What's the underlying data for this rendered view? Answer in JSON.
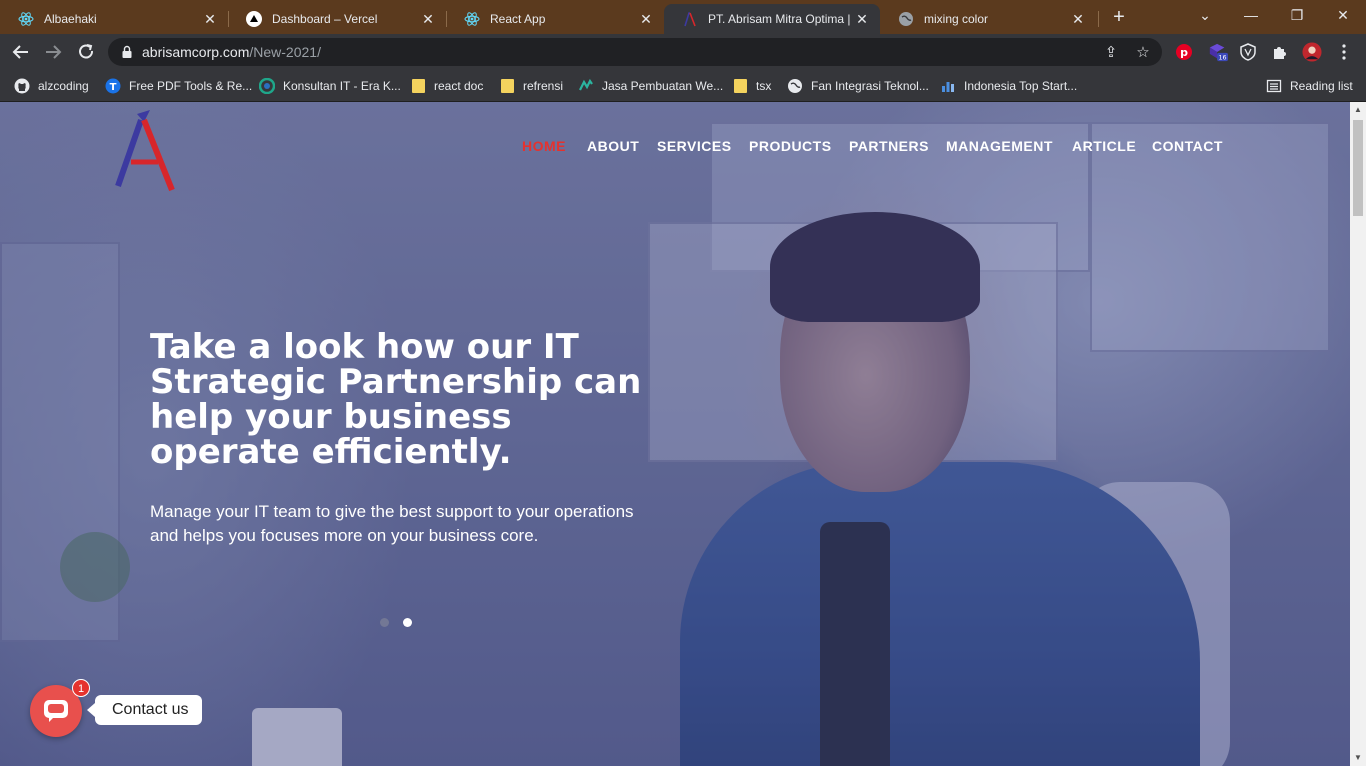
{
  "browser": {
    "tabs": [
      {
        "title": "Albaehaki",
        "icon": "react-icon",
        "active": false
      },
      {
        "title": "Dashboard – Vercel",
        "icon": "vercel-icon",
        "active": false
      },
      {
        "title": "React App",
        "icon": "react-icon",
        "active": false
      },
      {
        "title": "PT. Abrisam Mitra Optima | IT",
        "icon": "abrisam-icon",
        "active": true
      },
      {
        "title": "mixing color",
        "icon": "globe-icon",
        "active": false
      }
    ],
    "new_tab": "+",
    "url_host": "abrisamcorp.com",
    "url_path": "/New-2021/",
    "extension_badge": "16",
    "bookmarks": [
      {
        "label": "alzcoding",
        "icon": "github-icon"
      },
      {
        "label": "Free PDF Tools & Re...",
        "icon": "pdf-tool-icon"
      },
      {
        "label": "Konsultan IT - Era K...",
        "icon": "era-icon"
      },
      {
        "label": "react doc",
        "icon": "folder-icon"
      },
      {
        "label": "refrensi",
        "icon": "folder-icon"
      },
      {
        "label": "Jasa Pembuatan We...",
        "icon": "jasa-icon"
      },
      {
        "label": "tsx",
        "icon": "folder-icon"
      },
      {
        "label": "Fan Integrasi Teknol...",
        "icon": "globe-icon"
      },
      {
        "label": "Indonesia Top Start...",
        "icon": "chart-icon"
      }
    ],
    "reading_list": "Reading list"
  },
  "site": {
    "nav": {
      "home": "HOME",
      "about": "ABOUT",
      "services": "SERVICES",
      "products": "PRODUCTS",
      "partners": "PARTNERS",
      "management": "MANAGEMENT",
      "article": "ARTICLE",
      "contact": "CONTACT"
    },
    "hero": {
      "headline": "Take a look how our IT Strategic Partnership can help your business operate efficiently.",
      "subline": "Manage your IT team to give the best support to your operations and helps you focuses more on your business core.",
      "slide_count": 2,
      "active_slide": 2
    },
    "contact_widget": {
      "label": "Contact us",
      "badge": "1"
    }
  },
  "colors": {
    "tabstrip": "#5b3a1e",
    "toolbar": "#35363a",
    "nav_active": "#e5322e",
    "contact_button": "#e8504d",
    "logo_blue": "#3c3aa0",
    "logo_red": "#d7262b"
  }
}
